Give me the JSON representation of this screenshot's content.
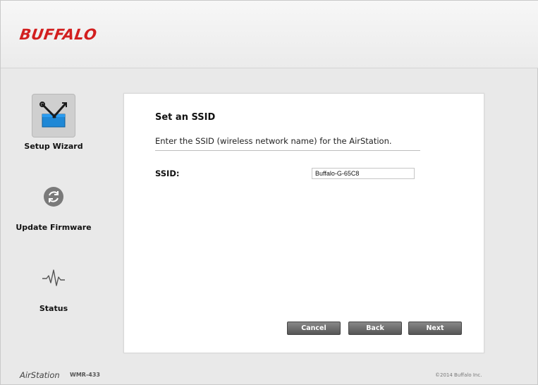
{
  "header": {
    "logo_text": "BUFFALO"
  },
  "sidebar": {
    "items": [
      {
        "label": "Setup Wizard",
        "icon": "toolbox-icon",
        "active": true
      },
      {
        "label": "Update Firmware",
        "icon": "refresh-icon",
        "active": false
      },
      {
        "label": "Status",
        "icon": "pulse-icon",
        "active": false
      }
    ]
  },
  "panel": {
    "title": "Set an SSID",
    "description": "Enter the SSID (wireless network name) for the AirStation.",
    "ssid_label": "SSID:",
    "ssid_value": "Buffalo-G-65C8"
  },
  "buttons": {
    "cancel": "Cancel",
    "back": "Back",
    "next": "Next"
  },
  "footer": {
    "brand": "AirStation",
    "model": "WMR-433",
    "copyright": "©2014 Buffalo Inc."
  },
  "colors": {
    "brand": "#d21f1f",
    "button": "#666666",
    "active_item_bg": "#cfcfcf"
  }
}
